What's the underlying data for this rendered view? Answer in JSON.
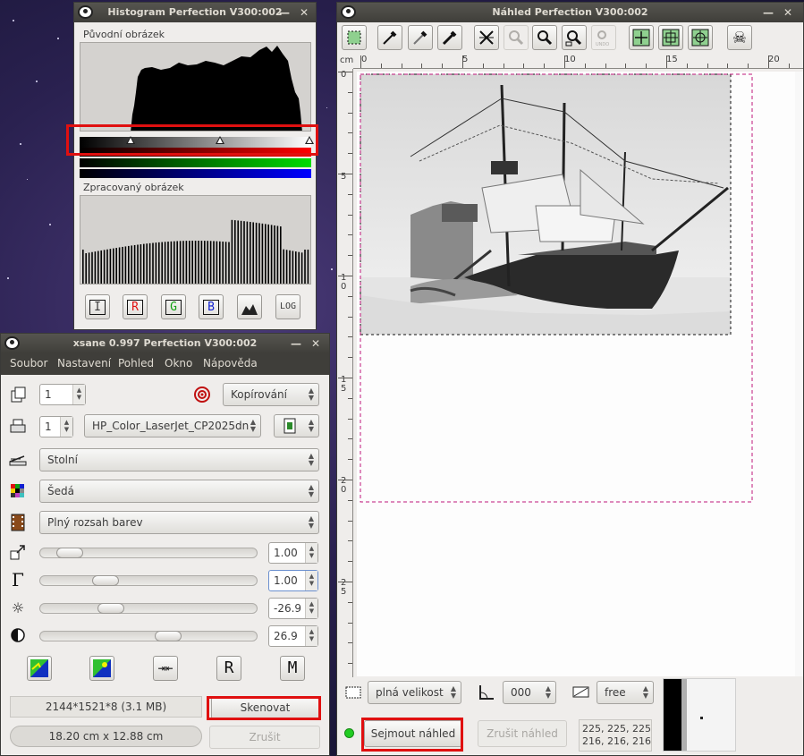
{
  "histogram_window": {
    "title": "Histogram Perfection V300:002",
    "original_label": "Původní obrázek",
    "processed_label": "Zpracovaný obrázek",
    "buttons": [
      {
        "name": "intensity-button",
        "label": "I",
        "color": "#111111"
      },
      {
        "name": "red-button",
        "label": "R",
        "color": "#e01010"
      },
      {
        "name": "green-button",
        "label": "G",
        "color": "#10a010"
      },
      {
        "name": "blue-button",
        "label": "B",
        "color": "#1020d0"
      },
      {
        "name": "pixel-button",
        "icon": "histogram-pixel-icon"
      },
      {
        "name": "log-button",
        "label": "LOG"
      }
    ]
  },
  "xsane_window": {
    "title": "xsane 0.997 Perfection V300:002",
    "menu": [
      "Soubor",
      "Nastavení",
      "Pohled",
      "Okno",
      "Nápověda"
    ],
    "copies_value": "1",
    "mode_label": "Kopírování",
    "printer_copies": "1",
    "printer_name": "HP_Color_LaserJet_CP2025dn",
    "source": "Stolní",
    "color_mode": "Šedá",
    "film": "Plný rozsah barev",
    "resolution_value": "1.00",
    "gamma_value": "1.00",
    "brightness_value": "-26.9",
    "contrast_value": "26.9",
    "image_info": "2144*1521*8 (3.1 MB)",
    "image_size": "18.20 cm x 12.88 cm",
    "scan_button": "Skenovat",
    "cancel_button": "Zrušit"
  },
  "preview_window": {
    "title": "Náhled Perfection V300:002",
    "ruler_unit": "cm",
    "h_ruler_labels": [
      "0",
      "5",
      "10",
      "15",
      "20"
    ],
    "v_ruler_labels": [
      "0",
      "5",
      "10",
      "15",
      "20",
      "25"
    ],
    "size_combo": "plná velikost",
    "rotation_combo": "000",
    "ratio_combo": "free",
    "acquire_button": "Sejmout náhled",
    "cancel_preview_button": "Zrušit náhled",
    "pixel_values_line1": "225, 225, 225",
    "pixel_values_line2": "216, 216, 216",
    "status_color": "#22cc22"
  }
}
